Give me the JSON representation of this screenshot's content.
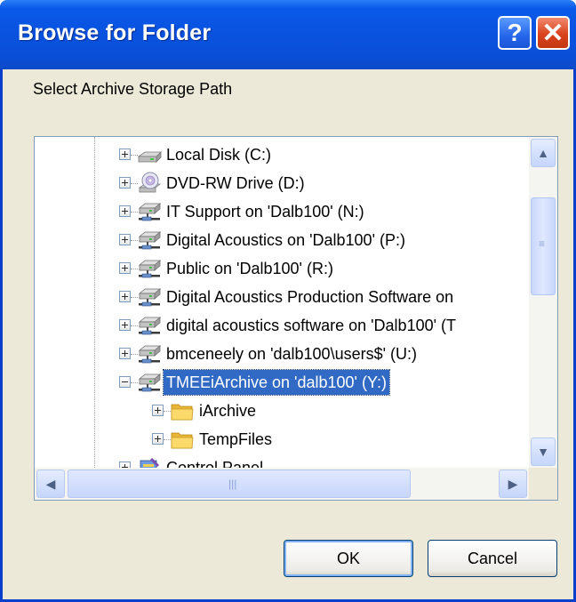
{
  "window": {
    "title": "Browse for Folder"
  },
  "titlebar_buttons": {
    "help_glyph": "?",
    "close_glyph": "✕"
  },
  "prompt": "Select Archive Storage Path",
  "tree": {
    "items": [
      {
        "label": "Local Disk (C:)",
        "icon": "hard-disk-icon",
        "expander": "plus",
        "level": 1,
        "selected": false
      },
      {
        "label": "DVD-RW Drive (D:)",
        "icon": "dvd-drive-icon",
        "expander": "plus",
        "level": 1,
        "selected": false
      },
      {
        "label": "IT Support on 'Dalb100' (N:)",
        "icon": "network-drive-icon",
        "expander": "plus",
        "level": 1,
        "selected": false
      },
      {
        "label": "Digital Acoustics on 'Dalb100' (P:)",
        "icon": "network-drive-icon",
        "expander": "plus",
        "level": 1,
        "selected": false
      },
      {
        "label": "Public on 'Dalb100' (R:)",
        "icon": "network-drive-icon",
        "expander": "plus",
        "level": 1,
        "selected": false
      },
      {
        "label": "Digital Acoustics Production Software on",
        "icon": "network-drive-icon",
        "expander": "plus",
        "level": 1,
        "selected": false
      },
      {
        "label": "digital acoustics software on 'Dalb100' (T",
        "icon": "network-drive-icon",
        "expander": "plus",
        "level": 1,
        "selected": false
      },
      {
        "label": "bmceneely on 'dalb100\\users$' (U:)",
        "icon": "network-drive-icon",
        "expander": "plus",
        "level": 1,
        "selected": false
      },
      {
        "label": "TMEEiArchive on 'dalb100' (Y:)",
        "icon": "network-drive-icon",
        "expander": "minus",
        "level": 1,
        "selected": true
      },
      {
        "label": "iArchive",
        "icon": "folder-icon",
        "expander": "plus",
        "level": 2,
        "selected": false
      },
      {
        "label": "TempFiles",
        "icon": "folder-icon",
        "expander": "plus",
        "level": 2,
        "selected": false
      },
      {
        "label": "Control Panel",
        "icon": "control-panel-icon",
        "expander": "plus",
        "level": 1,
        "selected": false
      }
    ]
  },
  "scrollbars": {
    "up_glyph": "▲",
    "down_glyph": "▼",
    "left_glyph": "◀",
    "right_glyph": "▶",
    "vertical_grip": "≡",
    "horizontal_grip": "|||"
  },
  "buttons": {
    "ok": "OK",
    "cancel": "Cancel"
  },
  "colors": {
    "titlebar": "#0a5ae9",
    "selection": "#316ac5",
    "dialog_bg": "#ece9d8",
    "close": "#d9421c"
  }
}
